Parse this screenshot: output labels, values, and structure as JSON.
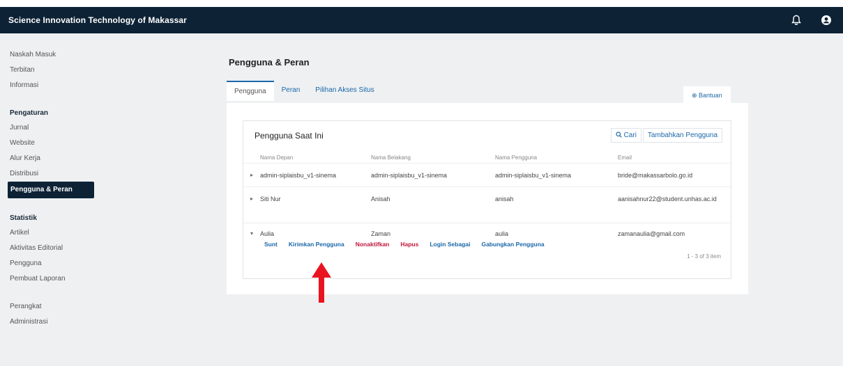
{
  "header": {
    "site_title": "Science Innovation Technology of Makassar",
    "icons": [
      "bell-icon",
      "user-avatar-icon"
    ]
  },
  "sidebar": {
    "groups": [
      {
        "heading": "",
        "items": [
          "Naskah Masuk",
          "Terbitan",
          "Informasi"
        ]
      },
      {
        "heading": "Pengaturan",
        "items": [
          "Jurnal",
          "Website",
          "Alur Kerja",
          "Distribusi",
          "Pengguna & Peran"
        ]
      },
      {
        "heading": "Statistik",
        "items": [
          "Artikel",
          "Aktivitas Editorial",
          "Pengguna",
          "Pembuat Laporan"
        ]
      },
      {
        "heading": "",
        "items": [
          "Perangkat",
          "Administrasi"
        ]
      }
    ],
    "active_item": "Pengguna & Peran"
  },
  "main": {
    "title": "Pengguna & Peran",
    "tabs": [
      "Pengguna",
      "Peran",
      "Pilihan Akses Situs"
    ],
    "active_tab": "Pengguna",
    "help_label": "⊕ Bantuan"
  },
  "users_card": {
    "title": "Pengguna Saat Ini",
    "search_label": "Cari",
    "add_label": "Tambahkan Pengguna",
    "columns": [
      "Nama Depan",
      "Nama Belakang",
      "Nama Pengguna",
      "Email"
    ],
    "rows": [
      {
        "first": "admin-siplaisbu_v1-sinema",
        "last": "admin-siplaisbu_v1-sinema",
        "username": "admin-siplaisbu_v1-sinema",
        "email": "bride@makassarbolo.go.id"
      },
      {
        "first": "Siti Nur",
        "last": "Anisah",
        "username": "anisah",
        "email": "aanisahnur22@student.unhas.ac.id"
      },
      {
        "first": "Aulia",
        "last": "Zaman",
        "username": "aulia",
        "email": "zamanaulia@gmail.com"
      }
    ],
    "row_actions": [
      "Sunt",
      "Kirimkan Pengguna",
      "Nonaktifkan",
      "Hapus",
      "Login Sebagai",
      "Gabungkan Pengguna"
    ],
    "pagination": "1 - 3 of 3 item"
  },
  "colors": {
    "header_bg": "#0d2235",
    "link": "#1a67a8",
    "danger": "#c0153b",
    "annotation_arrow": "#e8141f"
  }
}
